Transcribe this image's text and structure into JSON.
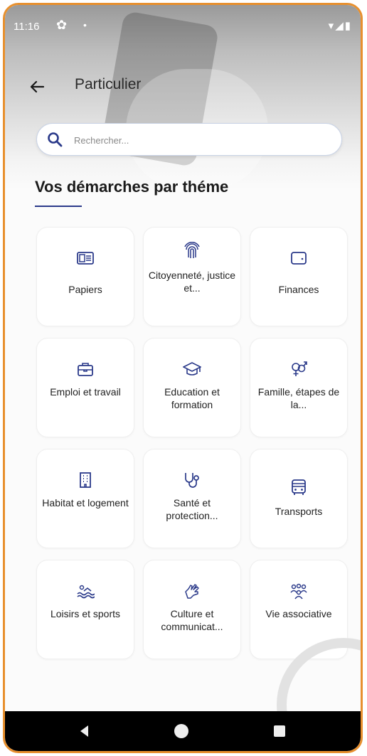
{
  "status": {
    "time": "11:16",
    "icons": "▾◢▮"
  },
  "topbar": {
    "title": "Particulier"
  },
  "search": {
    "placeholder": "Rechercher..."
  },
  "section": {
    "title": "Vos démarches par théme"
  },
  "themes": [
    {
      "label": "Papiers",
      "icon": "id-card-icon"
    },
    {
      "label": "Citoyenneté, justice et...",
      "icon": "fingerprint-icon"
    },
    {
      "label": "Finances",
      "icon": "wallet-icon"
    },
    {
      "label": "Emploi et travail",
      "icon": "briefcase-icon"
    },
    {
      "label": "Education et formation",
      "icon": "graduation-cap-icon"
    },
    {
      "label": "Famille, étapes de la...",
      "icon": "gender-icon"
    },
    {
      "label": "Habitat et logement",
      "icon": "building-icon"
    },
    {
      "label": "Santé et protection...",
      "icon": "stethoscope-icon"
    },
    {
      "label": "Transports",
      "icon": "bus-icon"
    },
    {
      "label": "Loisirs et sports",
      "icon": "swimming-icon"
    },
    {
      "label": "Culture et communicat...",
      "icon": "sign-language-icon"
    },
    {
      "label": "Vie associative",
      "icon": "people-group-icon"
    }
  ],
  "colors": {
    "accent": "#2b3a8a",
    "frame": "#e8902e"
  }
}
